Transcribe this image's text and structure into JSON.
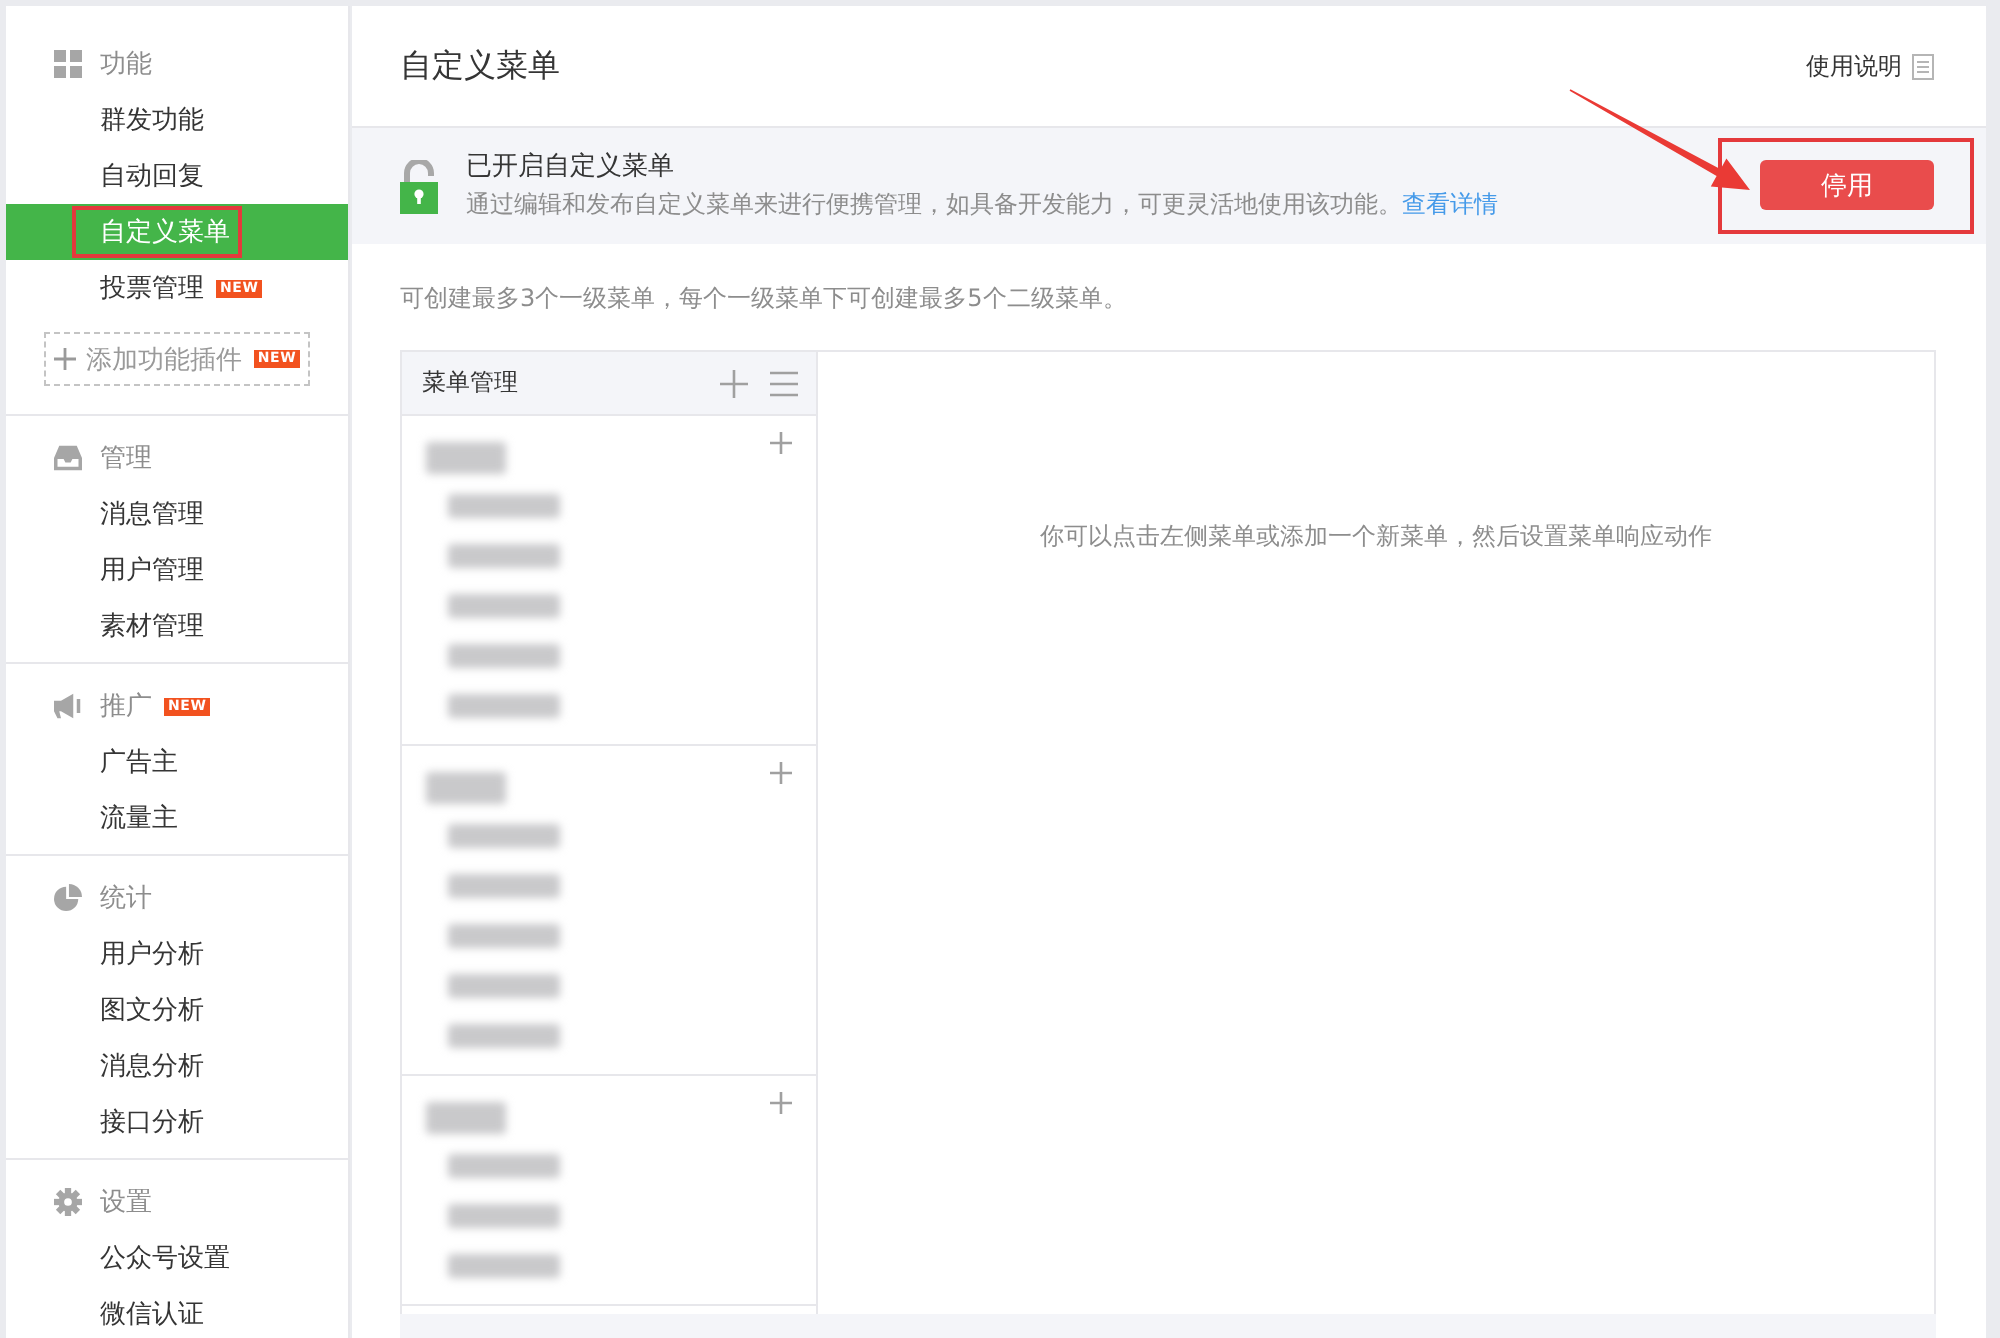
{
  "sidebar": {
    "sections": [
      {
        "kind": "grid",
        "title": "功能",
        "items": [
          {
            "label": "群发功能",
            "selected": false,
            "outlined": false
          },
          {
            "label": "自动回复",
            "selected": false,
            "outlined": false
          },
          {
            "label": "自定义菜单",
            "selected": true,
            "outlined": true
          },
          {
            "label": "投票管理",
            "selected": false,
            "outlined": false,
            "badge": "NEW"
          }
        ],
        "plugin_button": {
          "label": "添加功能插件",
          "badge": "NEW"
        }
      },
      {
        "kind": "inbox",
        "title": "管理",
        "items": [
          {
            "label": "消息管理",
            "selected": false,
            "outlined": false
          },
          {
            "label": "用户管理",
            "selected": false,
            "outlined": false
          },
          {
            "label": "素材管理",
            "selected": false,
            "outlined": false
          }
        ]
      },
      {
        "kind": "megaphone",
        "title": "推广",
        "badge": "NEW",
        "items": [
          {
            "label": "广告主",
            "selected": false,
            "outlined": false
          },
          {
            "label": "流量主",
            "selected": false,
            "outlined": false
          }
        ]
      },
      {
        "kind": "pie",
        "title": "统计",
        "items": [
          {
            "label": "用户分析",
            "selected": false,
            "outlined": false
          },
          {
            "label": "图文分析",
            "selected": false,
            "outlined": false
          },
          {
            "label": "消息分析",
            "selected": false,
            "outlined": false
          },
          {
            "label": "接口分析",
            "selected": false,
            "outlined": false
          }
        ]
      },
      {
        "kind": "gear",
        "title": "设置",
        "items": [
          {
            "label": "公众号设置",
            "selected": false,
            "outlined": false
          },
          {
            "label": "微信认证",
            "selected": false,
            "outlined": false
          }
        ]
      }
    ]
  },
  "main": {
    "title": "自定义菜单",
    "help_link": "使用说明",
    "notice": {
      "title": "已开启自定义菜单",
      "text": "通过编辑和发布自定义菜单来进行便携管理，如具备开发能力，可更灵活地使用该功能。",
      "link": "查看详情",
      "button": "停用",
      "button_outlined": true,
      "callout_arrow": true
    },
    "hint": "可创建最多3个一级菜单，每个一级菜单下可创建最多5个二级菜单。",
    "menu_panel": {
      "title": "菜单管理",
      "groups": [
        {
          "redacted": true,
          "children": [
            {
              "redacted": true
            },
            {
              "redacted": true
            },
            {
              "redacted": true
            },
            {
              "redacted": true
            },
            {
              "redacted": true
            }
          ]
        },
        {
          "redacted": true,
          "children": [
            {
              "redacted": true
            },
            {
              "redacted": true
            },
            {
              "redacted": true
            },
            {
              "redacted": true
            },
            {
              "redacted": true
            }
          ]
        },
        {
          "redacted": true,
          "children": [
            {
              "redacted": true
            },
            {
              "redacted": true
            },
            {
              "redacted": true
            }
          ]
        }
      ],
      "empty_text": "你可以点击左侧菜单或添加一个新菜单，然后设置菜单响应动作"
    }
  }
}
